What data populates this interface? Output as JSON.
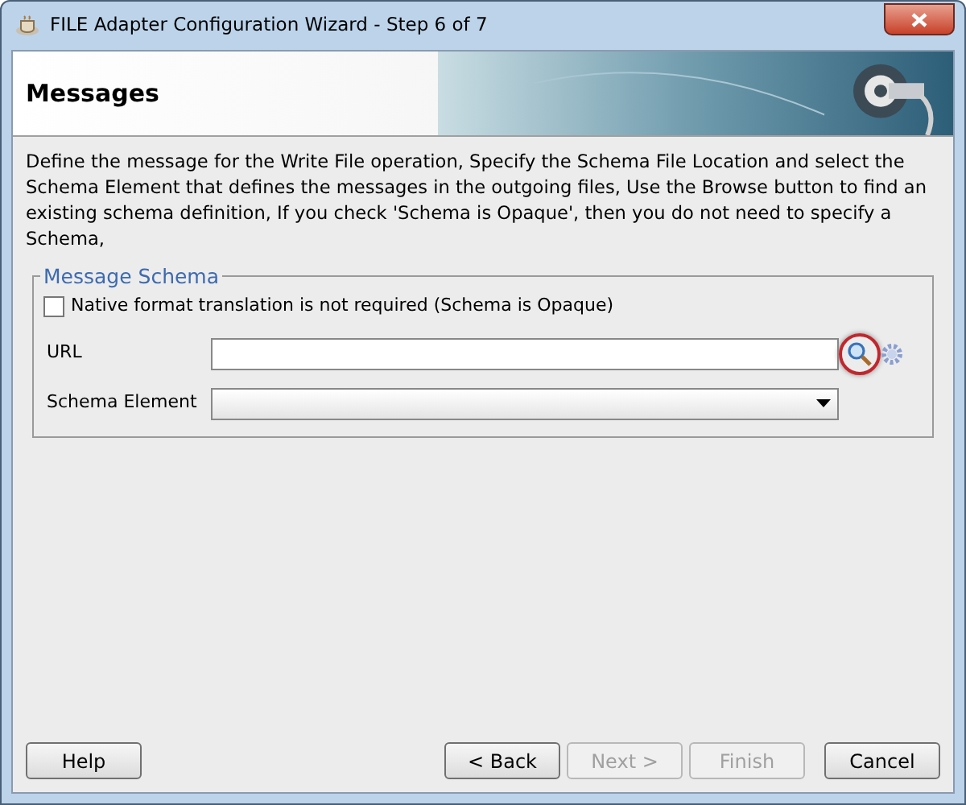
{
  "window": {
    "title": "FILE Adapter Configuration Wizard - Step 6 of 7"
  },
  "header": {
    "title": "Messages"
  },
  "description": "Define the message for the Write File operation,  Specify the Schema File Location and select the Schema Element that defines the messages in the outgoing files, Use the Browse button to find an existing schema definition, If you check 'Schema is Opaque', then you do not need to specify a Schema,",
  "group": {
    "legend": "Message Schema",
    "opaque_checkbox": {
      "label": "Native format translation is not required (Schema is Opaque)",
      "checked": false
    },
    "url": {
      "label": "URL",
      "browse_highlighted": true
    },
    "schema_element": {
      "label": "Schema Element"
    }
  },
  "help_button": {
    "label": "Help",
    "disabled": false
  },
  "nav_buttons": [
    {
      "label": "< Back",
      "disabled": false
    },
    {
      "label": "Next >",
      "disabled": true
    },
    {
      "label": "Finish",
      "disabled": true
    },
    {
      "label": "Cancel",
      "disabled": false
    }
  ]
}
